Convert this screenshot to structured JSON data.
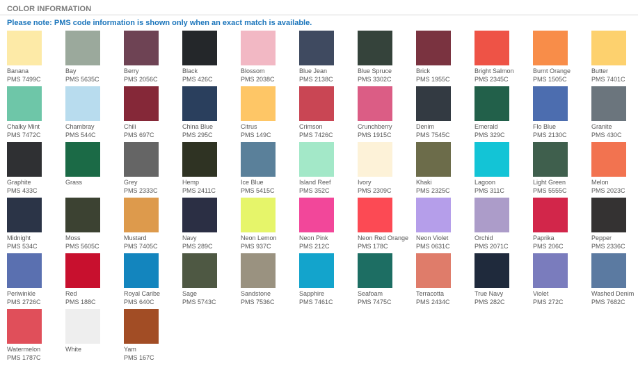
{
  "header": {
    "title": "COLOR INFORMATION"
  },
  "note": "Please note: PMS code information is shown only when an exact match is available.",
  "colors": [
    {
      "name": "Banana",
      "pms": "PMS 7499C",
      "hex": "#fdeaa7"
    },
    {
      "name": "Bay",
      "pms": "PMS 5635C",
      "hex": "#9ba99c"
    },
    {
      "name": "Berry",
      "pms": "PMS 2056C",
      "hex": "#6e4354"
    },
    {
      "name": "Black",
      "pms": "PMS 426C",
      "hex": "#24272a"
    },
    {
      "name": "Blossom",
      "pms": "PMS 2038C",
      "hex": "#f2b8c4"
    },
    {
      "name": "Blue Jean",
      "pms": "PMS 2138C",
      "hex": "#3f4a60"
    },
    {
      "name": "Blue Spruce",
      "pms": "PMS 3302C",
      "hex": "#35433b"
    },
    {
      "name": "Brick",
      "pms": "PMS 1955C",
      "hex": "#7a3340"
    },
    {
      "name": "Bright Salmon",
      "pms": "PMS 2345C",
      "hex": "#ee5346"
    },
    {
      "name": "Burnt Orange",
      "pms": "PMS 1505C",
      "hex": "#f88d49"
    },
    {
      "name": "Butter",
      "pms": "PMS 7401C",
      "hex": "#fdd16e"
    },
    {
      "name": "Chalky Mint",
      "pms": "PMS 7472C",
      "hex": "#6ec6a8"
    },
    {
      "name": "Chambray",
      "pms": "PMS 544C",
      "hex": "#b8dcee"
    },
    {
      "name": "Chili",
      "pms": "PMS 697C",
      "hex": "#852838"
    },
    {
      "name": "China Blue",
      "pms": "PMS 295C",
      "hex": "#2a3f5d"
    },
    {
      "name": "Citrus",
      "pms": "PMS 149C",
      "hex": "#fec666"
    },
    {
      "name": "Crimson",
      "pms": "PMS 7426C",
      "hex": "#c94654"
    },
    {
      "name": "Crunchberry",
      "pms": "PMS 1915C",
      "hex": "#db5d85"
    },
    {
      "name": "Denim",
      "pms": "PMS 7545C",
      "hex": "#333a42"
    },
    {
      "name": "Emerald",
      "pms": "PMS 329C",
      "hex": "#22604a"
    },
    {
      "name": "Flo Blue",
      "pms": "PMS 2130C",
      "hex": "#4c6daf"
    },
    {
      "name": "Granite",
      "pms": "PMS 430C",
      "hex": "#6b757d"
    },
    {
      "name": "Graphite",
      "pms": "PMS 433C",
      "hex": "#2f3033"
    },
    {
      "name": "Grass",
      "pms": "",
      "hex": "#1b6a46"
    },
    {
      "name": "Grey",
      "pms": "PMS 2333C",
      "hex": "#656565"
    },
    {
      "name": "Hemp",
      "pms": "PMS 2411C",
      "hex": "#2f3323"
    },
    {
      "name": "Ice Blue",
      "pms": "PMS 5415C",
      "hex": "#5a809a"
    },
    {
      "name": "Island Reef",
      "pms": "PMS 352C",
      "hex": "#a3e8c8"
    },
    {
      "name": "Ivory",
      "pms": "PMS 2309C",
      "hex": "#fdf2d8"
    },
    {
      "name": "Khaki",
      "pms": "PMS 2325C",
      "hex": "#6c6c4a"
    },
    {
      "name": "Lagoon",
      "pms": "PMS 311C",
      "hex": "#13c4d6"
    },
    {
      "name": "Light Green",
      "pms": "PMS 5555C",
      "hex": "#3f5f4d"
    },
    {
      "name": "Melon",
      "pms": "PMS 2023C",
      "hex": "#f27350"
    },
    {
      "name": "Midnight",
      "pms": "PMS 534C",
      "hex": "#2b3447"
    },
    {
      "name": "Moss",
      "pms": "PMS 5605C",
      "hex": "#3c4232"
    },
    {
      "name": "Mustard",
      "pms": "PMS 7405C",
      "hex": "#dd9a4c"
    },
    {
      "name": "Navy",
      "pms": "PMS 289C",
      "hex": "#2b2f44"
    },
    {
      "name": "Neon Lemon",
      "pms": "PMS 937C",
      "hex": "#e6f56a"
    },
    {
      "name": "Neon Pink",
      "pms": "PMS 212C",
      "hex": "#f2479a"
    },
    {
      "name": "Neon Red Orange",
      "pms": "PMS 178C",
      "hex": "#fc4a54"
    },
    {
      "name": "Neon Violet",
      "pms": "PMS 0631C",
      "hex": "#b59eea"
    },
    {
      "name": "Orchid",
      "pms": "PMS 2071C",
      "hex": "#ac9cc9"
    },
    {
      "name": "Paprika",
      "pms": "PMS 206C",
      "hex": "#d2264a"
    },
    {
      "name": "Pepper",
      "pms": "PMS 2336C",
      "hex": "#343232"
    },
    {
      "name": "Periwinkle",
      "pms": "PMS 2726C",
      "hex": "#5a70b0"
    },
    {
      "name": "Red",
      "pms": "PMS 188C",
      "hex": "#c8102e"
    },
    {
      "name": "Royal Caribe",
      "pms": "PMS 640C",
      "hex": "#1385be"
    },
    {
      "name": "Sage",
      "pms": "PMS 5743C",
      "hex": "#4e5843"
    },
    {
      "name": "Sandstone",
      "pms": "PMS 7536C",
      "hex": "#9a9280"
    },
    {
      "name": "Sapphire",
      "pms": "PMS 7461C",
      "hex": "#13a4cc"
    },
    {
      "name": "Seafoam",
      "pms": "PMS 7475C",
      "hex": "#1d6e63"
    },
    {
      "name": "Terracotta",
      "pms": "PMS 2434C",
      "hex": "#df7c6a"
    },
    {
      "name": "True Navy",
      "pms": "PMS 282C",
      "hex": "#1f2a3c"
    },
    {
      "name": "Violet",
      "pms": "PMS 272C",
      "hex": "#7a7cbd"
    },
    {
      "name": "Washed Denim",
      "pms": "PMS 7682C",
      "hex": "#5b7aa1"
    },
    {
      "name": "Watermelon",
      "pms": "PMS 1787C",
      "hex": "#e04f5a"
    },
    {
      "name": "White",
      "pms": "",
      "hex": "#eeeeee"
    },
    {
      "name": "Yam",
      "pms": "PMS 167C",
      "hex": "#a24d25"
    }
  ]
}
